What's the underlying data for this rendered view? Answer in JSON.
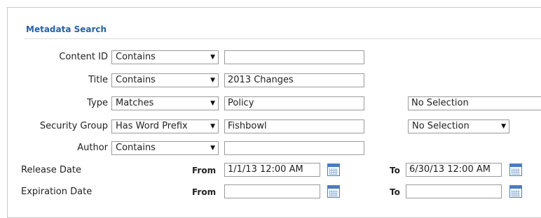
{
  "section": {
    "title": "Metadata Search"
  },
  "fields": {
    "content_id": {
      "label": "Content ID",
      "operator": "Contains",
      "value": ""
    },
    "title": {
      "label": "Title",
      "operator": "Contains",
      "value": "2013 Changes"
    },
    "type": {
      "label": "Type",
      "operator": "Matches",
      "value": "Policy",
      "extra": "No Selection"
    },
    "security_group": {
      "label": "Security Group",
      "operator": "Has Word Prefix",
      "value": "Fishbowl",
      "extra": "No Selection"
    },
    "author": {
      "label": "Author",
      "operator": "Contains",
      "value": ""
    },
    "release_date": {
      "label": "Release Date",
      "from_label": "From",
      "to_label": "To",
      "from": "1/1/13 12:00 AM",
      "to": "6/30/13 12:00 AM"
    },
    "expiration_date": {
      "label": "Expiration Date",
      "from_label": "From",
      "to_label": "To",
      "from": "",
      "to": ""
    }
  },
  "icons": {
    "dropdown": "dropdown-arrow-icon",
    "calendar": "calendar-icon"
  },
  "colors": {
    "section_title": "#2561a8",
    "border": "#9a9a9a",
    "calendar": "#4a7cc0"
  }
}
